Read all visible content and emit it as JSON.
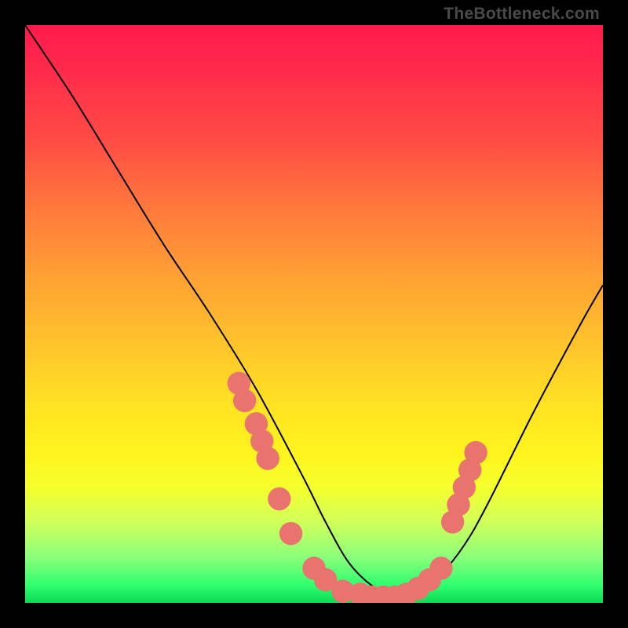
{
  "watermark": "TheBottleneck.com",
  "chart_data": {
    "type": "line",
    "title": "",
    "xlabel": "",
    "ylabel": "",
    "xlim": [
      0,
      100
    ],
    "ylim": [
      0,
      100
    ],
    "grid": false,
    "legend": false,
    "series": [
      {
        "name": "bottleneck-curve",
        "color": "#000000",
        "x": [
          0,
          8,
          16,
          24,
          32,
          40,
          48,
          52,
          56,
          60,
          64,
          68,
          72,
          76,
          80,
          88,
          96,
          100
        ],
        "y": [
          100,
          88,
          75,
          62,
          50,
          37,
          22,
          14,
          7,
          3,
          1,
          2,
          5,
          10,
          17,
          33,
          48,
          55
        ]
      }
    ],
    "markers": {
      "name": "dot-cluster",
      "color": "#e9736e",
      "radius": 2.0,
      "points": [
        {
          "x": 37,
          "y": 38
        },
        {
          "x": 38,
          "y": 35
        },
        {
          "x": 40,
          "y": 31
        },
        {
          "x": 41,
          "y": 28
        },
        {
          "x": 42,
          "y": 25
        },
        {
          "x": 44,
          "y": 18
        },
        {
          "x": 46,
          "y": 12
        },
        {
          "x": 50,
          "y": 6
        },
        {
          "x": 52,
          "y": 4
        },
        {
          "x": 55,
          "y": 2
        },
        {
          "x": 58,
          "y": 1.5
        },
        {
          "x": 60,
          "y": 1
        },
        {
          "x": 62,
          "y": 1
        },
        {
          "x": 64,
          "y": 1
        },
        {
          "x": 66,
          "y": 1.5
        },
        {
          "x": 68,
          "y": 2.5
        },
        {
          "x": 70,
          "y": 4
        },
        {
          "x": 72,
          "y": 6
        },
        {
          "x": 74,
          "y": 14
        },
        {
          "x": 75,
          "y": 17
        },
        {
          "x": 76,
          "y": 20
        },
        {
          "x": 77,
          "y": 23
        },
        {
          "x": 78,
          "y": 26
        }
      ]
    }
  }
}
